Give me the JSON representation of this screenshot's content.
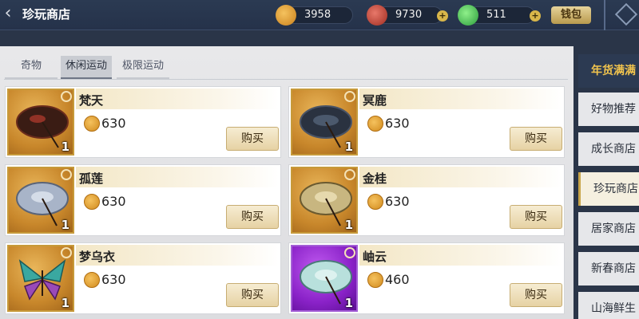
{
  "header": {
    "back_icon": "chevron-left-icon",
    "title": "珍玩商店",
    "currencies": [
      {
        "icon": "gold-ingot-icon",
        "value": "3958",
        "color": "#d89a2a"
      },
      {
        "icon": "red-coin-icon",
        "value": "9730",
        "color": "#c8483a"
      },
      {
        "icon": "jade-coin-icon",
        "value": "511",
        "color": "#46c05a"
      }
    ],
    "wallet_label": "钱包"
  },
  "tabs": [
    {
      "label": "奇物",
      "active": false
    },
    {
      "label": "休闲运动",
      "active": true
    },
    {
      "label": "极限运动",
      "active": false
    }
  ],
  "items": [
    {
      "name": "梵天",
      "price": "630",
      "qty": "1",
      "rarity": "gold",
      "art": "umbrella-dark-red"
    },
    {
      "name": "冥鹿",
      "price": "630",
      "qty": "1",
      "rarity": "gold",
      "art": "umbrella-dark-blue"
    },
    {
      "name": "孤莲",
      "price": "630",
      "qty": "1",
      "rarity": "gold",
      "art": "umbrella-blue-white"
    },
    {
      "name": "金桂",
      "price": "630",
      "qty": "1",
      "rarity": "gold",
      "art": "umbrella-gold"
    },
    {
      "name": "梦乌衣",
      "price": "630",
      "qty": "1",
      "rarity": "gold",
      "art": "butterfly-kite"
    },
    {
      "name": "岫云",
      "price": "460",
      "qty": "1",
      "rarity": "purple",
      "art": "umbrella-teal"
    }
  ],
  "buy_label": "购买",
  "sidenav": [
    {
      "label": "年货满满",
      "style": "first"
    },
    {
      "label": "好物推荐",
      "style": "normal"
    },
    {
      "label": "成长商店",
      "style": "normal"
    },
    {
      "label": "珍玩商店",
      "style": "active"
    },
    {
      "label": "居家商店",
      "style": "normal"
    },
    {
      "label": "新春商店",
      "style": "normal"
    },
    {
      "label": "山海鲜生",
      "style": "normal"
    }
  ]
}
